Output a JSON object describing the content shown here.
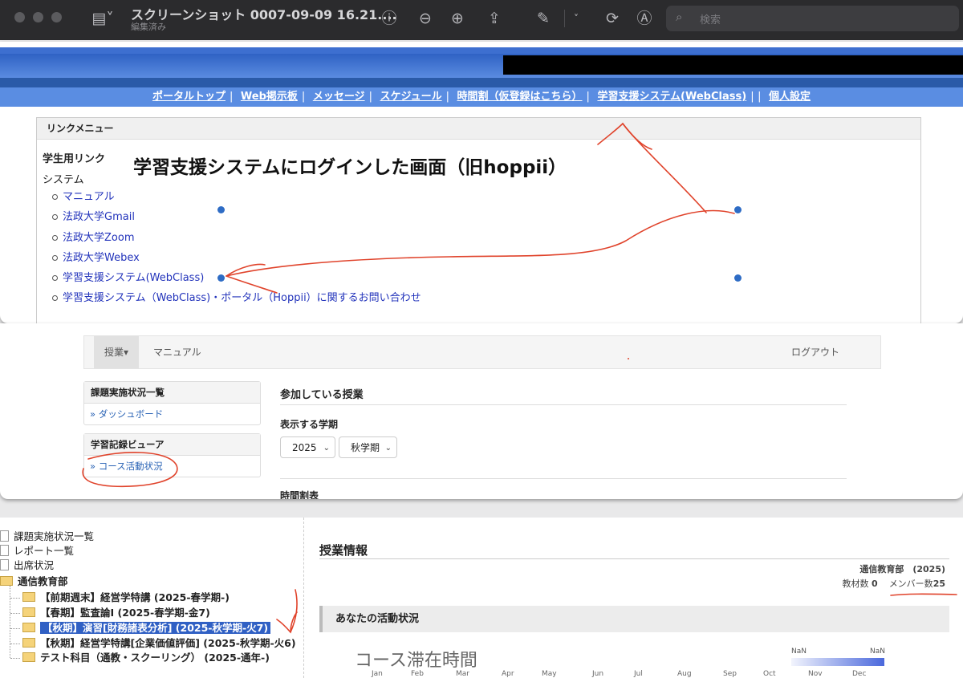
{
  "toolbar": {
    "title": "スクリーンショット 0007-09-09 16.21....",
    "subtitle": "編集済み",
    "search_placeholder": "検索"
  },
  "portal": {
    "nav": [
      "ポータルトップ",
      "Web掲示板",
      "メッセージ",
      "スケジュール",
      "時間割（仮登録はこちら）",
      "学習支援システム(WebClass)",
      "個人設定"
    ],
    "link_menu_title": "リンクメニュー",
    "student_links": "学生用リンク",
    "system_label": "システム",
    "links": [
      "マニュアル",
      "法政大学Gmail",
      "法政大学Zoom",
      "法政大学Webex",
      "学習支援システム(WebClass)",
      "学習支援システム（WebClass)・ポータル（Hoppii）に関するお問い合わせ"
    ],
    "annotation": "学習支援システムにログインした画面（旧hoppii）"
  },
  "webclass": {
    "nav_tab": "授業▾",
    "nav_manual": "マニュアル",
    "nav_logout": "ログアウト",
    "side1_title": "課題実施状況一覧",
    "side1_link": "» ダッシュボード",
    "side2_title": "学習記録ビューア",
    "side2_link": "» コース活動状況",
    "main_title": "参加している授業",
    "term_label": "表示する学期",
    "year": "2025",
    "term": "秋学期",
    "timetable": "時間割表"
  },
  "course": {
    "tree": [
      {
        "label": "課題実施状況一覧",
        "icon": "document-icon"
      },
      {
        "label": "レポート一覧",
        "icon": "document-icon"
      },
      {
        "label": "出席状況",
        "icon": "document-icon"
      },
      {
        "label": "通信教育部",
        "icon": "folder-icon"
      },
      {
        "label": "【前期週末】経営学特講 (2025-春学期-)",
        "icon": "folder-icon"
      },
      {
        "label": "【春期】監査論I (2025-春学期-金7)",
        "icon": "folder-icon"
      },
      {
        "label": "【秋期】演習[財務諸表分析] (2025-秋学期-火7)",
        "icon": "folder-icon"
      },
      {
        "label": "【秋期】経営学特講[企業価値評価] (2025-秋学期-火6)",
        "icon": "folder-icon"
      },
      {
        "label": "テスト科目（通教・スクーリング） (2025-通年-)",
        "icon": "folder-icon"
      }
    ],
    "info_title": "授業情報",
    "dept": "通信教育部　(2025)",
    "materials_label": "教材数",
    "materials": "0",
    "members_label": "メンバー数",
    "members": "25",
    "activity_title": "あなたの活動状況",
    "chart_title": "コース滞在時間",
    "legend_min": "NaN",
    "legend_max": "NaN",
    "months": [
      "Jan",
      "Feb",
      "Mar",
      "Apr",
      "May",
      "Jun",
      "Jul",
      "Aug",
      "Sep",
      "Oct",
      "Nov",
      "Dec"
    ]
  },
  "colors": {
    "annotation_red": "#e0432b",
    "handle_blue": "#2e6cc5",
    "selected_blue": "#3060c4"
  }
}
